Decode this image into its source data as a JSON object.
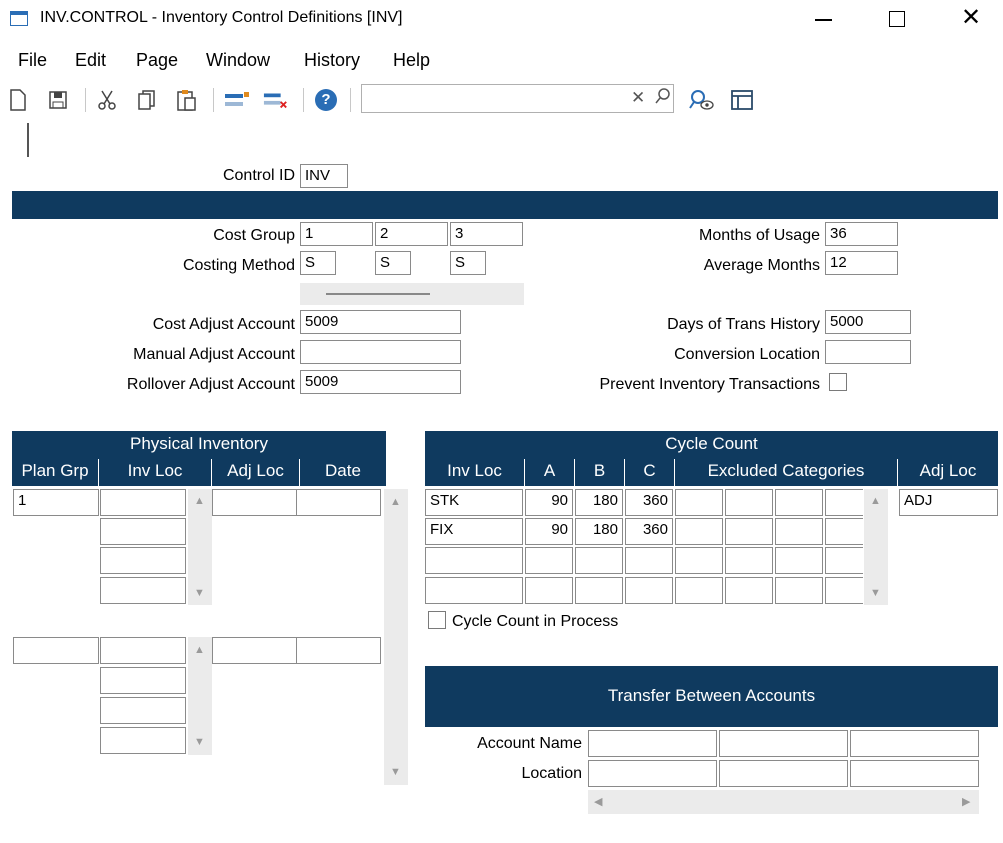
{
  "window": {
    "title": "INV.CONTROL - Inventory Control Definitions [INV]"
  },
  "menu": {
    "items": [
      "File",
      "Edit",
      "Page",
      "Window",
      "History",
      "Help"
    ]
  },
  "toolbar": {
    "search_value": ""
  },
  "header": {
    "control_id_label": "Control ID",
    "control_id_value": "INV"
  },
  "costing": {
    "cost_group_label": "Cost Group",
    "cost_groups": [
      "1",
      "2",
      "3"
    ],
    "costing_method_label": "Costing Method",
    "costing_methods": [
      "S",
      "S",
      "S"
    ],
    "months_of_usage_label": "Months of Usage",
    "months_of_usage": "36",
    "average_months_label": "Average Months",
    "average_months": "12"
  },
  "accounts": {
    "cost_adjust_label": "Cost Adjust Account",
    "cost_adjust_value": "5009",
    "manual_adjust_label": "Manual Adjust Account",
    "manual_adjust_value": "",
    "rollover_adjust_label": "Rollover Adjust Account",
    "rollover_adjust_value": "5009",
    "days_trans_history_label": "Days of Trans History",
    "days_trans_history_value": "5000",
    "conversion_location_label": "Conversion Location",
    "conversion_location_value": "",
    "prevent_inv_trans_label": "Prevent Inventory Transactions",
    "prevent_inv_trans_checked": false
  },
  "physical_inventory": {
    "title": "Physical Inventory",
    "columns": [
      "Plan Grp",
      "Inv Loc",
      "Adj Loc",
      "Date"
    ],
    "plan_grp_1": "1",
    "plan_grp_2": ""
  },
  "cycle_count": {
    "title": "Cycle Count",
    "columns": [
      "Inv Loc",
      "A",
      "B",
      "C",
      "Excluded Categories",
      "Adj Loc"
    ],
    "rows": [
      {
        "inv_loc": "STK",
        "a": "90",
        "b": "180",
        "c": "360"
      },
      {
        "inv_loc": "FIX",
        "a": "90",
        "b": "180",
        "c": "360"
      }
    ],
    "adj_loc": "ADJ",
    "in_process_label": "Cycle Count in Process",
    "in_process_checked": false
  },
  "transfer": {
    "title": "Transfer Between Accounts",
    "account_name_label": "Account Name",
    "location_label": "Location"
  },
  "colors": {
    "header_bg": "#0f3a5f",
    "scroll_bg": "#ebebeb"
  },
  "icons": [
    "window-icon",
    "minimize-icon",
    "maximize-icon",
    "close-icon",
    "new-icon",
    "save-icon",
    "cut-icon",
    "copy-icon",
    "paste-icon",
    "insert-row-icon",
    "delete-row-icon",
    "help-icon",
    "clear-icon",
    "search-icon",
    "zoom-icon",
    "layout-icon"
  ]
}
